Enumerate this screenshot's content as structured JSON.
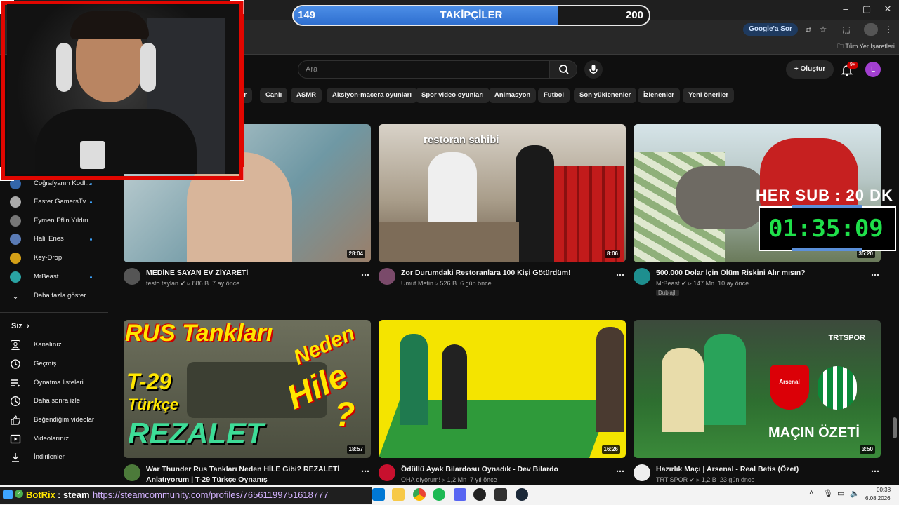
{
  "browser": {
    "google_sor": "Google'a Sor",
    "bookmarks_label": "Tüm Yer İşaretleri"
  },
  "progress": {
    "start": "149",
    "label": "TAKİPÇİLER",
    "end": "200",
    "fill_fraction": 0.745
  },
  "header": {
    "search_placeholder": "Ara",
    "create_label": "Oluştur",
    "notif_badge": "9+",
    "avatar_letter": "L"
  },
  "chips": [
    "er",
    "Canlı",
    "ASMR",
    "Aksiyon-macera oyunları",
    "Spor video oyunları",
    "Animasyon",
    "Futbol",
    "Son yüklenenler",
    "İzlenenler",
    "Yeni öneriler"
  ],
  "sidebar": {
    "subs": [
      {
        "label": "Coğrafyanın Kodl..."
      },
      {
        "label": "Easter GamersTv"
      },
      {
        "label": "Eymen Eflin Yıldırı..."
      },
      {
        "label": "Halil Enes"
      },
      {
        "label": "Key-Drop"
      },
      {
        "label": "MrBeast"
      }
    ],
    "show_more": "Daha fazla göster",
    "you_heading": "Siz",
    "you_items": [
      {
        "label": "Kanalınız",
        "icon": "person-icon"
      },
      {
        "label": "Geçmiş",
        "icon": "history-icon"
      },
      {
        "label": "Oynatma listeleri",
        "icon": "playlist-icon"
      },
      {
        "label": "Daha sonra izle",
        "icon": "clock-icon"
      },
      {
        "label": "Beğendiğim videolar",
        "icon": "thumbs-up-icon"
      },
      {
        "label": "Videolarınız",
        "icon": "video-icon"
      },
      {
        "label": "İndirilenler",
        "icon": "download-icon"
      }
    ]
  },
  "videos": [
    {
      "title": "MEDİNE SAYAN EV ZİYARETİ",
      "channel": "testo taylan",
      "views": "886 B",
      "age": "7 ay önce",
      "duration": "28:04",
      "thumb_text": ""
    },
    {
      "title": "Zor Durumdaki Restoranlara 100 Kişi Götürdüm!",
      "channel": "Umut Metin",
      "views": "526 B",
      "age": "6 gün önce",
      "duration": "8:06",
      "thumb_text": "restoran sahibi"
    },
    {
      "title": "500.000 Dolar İçin Ölüm Riskini Alır mısın?",
      "channel": "MrBeast",
      "views": "147 Mn",
      "age": "10 ay önce",
      "duration": "35:20",
      "badge": "Dublajlı",
      "thumb_text": ""
    },
    {
      "title": "War Thunder Rus Tankları Neden HİLE Gibi? REZALETİ",
      "title2": "Anlatıyorum | T-29 Türkçe Oynanış",
      "channel": "",
      "views": "",
      "age": "",
      "duration": "18:57",
      "thumb_text": "RUS Tankları",
      "thumb_text2": "T-29",
      "thumb_text3": "Türkçe",
      "thumb_text4": "REZALET",
      "thumb_text5": "Neden",
      "thumb_text6": "Hile",
      "thumb_text7": "?"
    },
    {
      "title": "Ödüllü Ayak Bilardosu Oynadık - Dev Bilardo",
      "channel": "OHA diyorum!",
      "views": "1,2 Mn",
      "age": "7 yıl önce",
      "duration": "16:26",
      "thumb_text": ""
    },
    {
      "title": "Hazırlık Maçı | Arsenal - Real Betis (Özet)",
      "channel": "TRT SPOR",
      "views": "1,2 B",
      "age": "23 gün önce",
      "duration": "3:50",
      "thumb_text": "MAÇIN ÖZETİ",
      "thumb_brand": "TRTSPOR",
      "thumb_team": "Arsenal"
    }
  ],
  "timer": {
    "heading": "HER SUB : 20 DK",
    "value": "01:35:09"
  },
  "taskbar": {
    "botrix": "BotRix",
    "steam_label": ": steam",
    "steam_url": "https://steamcommunity.com/profiles/76561199751618777",
    "time": "00:38",
    "date": "6.08.2026"
  },
  "colors": {
    "accent_blue": "#3ea6ff",
    "red": "#cc0000",
    "timer_green": "#1fe04a"
  }
}
